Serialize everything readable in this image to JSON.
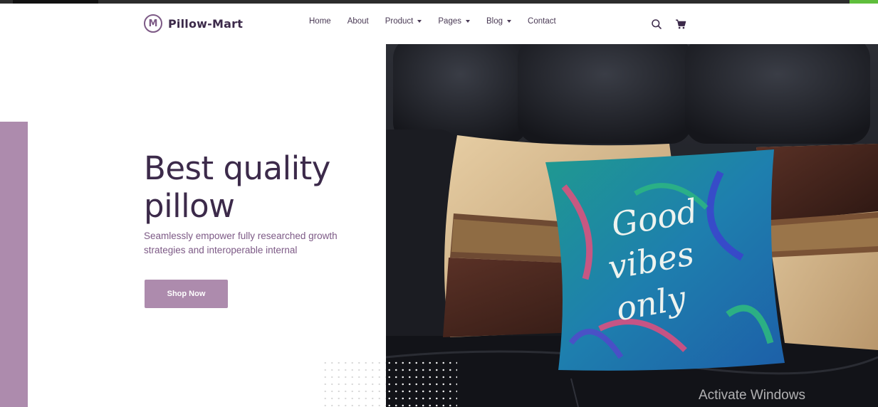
{
  "brand": {
    "name": "Pillow-Mart",
    "logo_letter": "M"
  },
  "nav": {
    "items": [
      {
        "label": "Home",
        "dropdown": false
      },
      {
        "label": "About",
        "dropdown": false
      },
      {
        "label": "Product",
        "dropdown": true
      },
      {
        "label": "Pages",
        "dropdown": true
      },
      {
        "label": "Blog",
        "dropdown": true
      },
      {
        "label": "Contact",
        "dropdown": false
      }
    ],
    "search_icon": "search-icon",
    "cart_icon": "cart-icon"
  },
  "hero": {
    "title_line1": "Best quality",
    "title_line2": "pillow",
    "description": "Seamlessly empower fully researched growth strategies and interoperable internal",
    "cta_label": "Shop Now",
    "image_pillow_text": [
      "Good",
      "vibes",
      "only"
    ]
  },
  "overlay": {
    "watermark": "Activate Windows"
  },
  "colors": {
    "accent": "#ad8bad",
    "heading": "#3c2a4a",
    "body_text": "#7d5a86",
    "sofa": "#17181c",
    "topbar": "#2d2d2d",
    "topbar_green": "#5fbe3c"
  }
}
